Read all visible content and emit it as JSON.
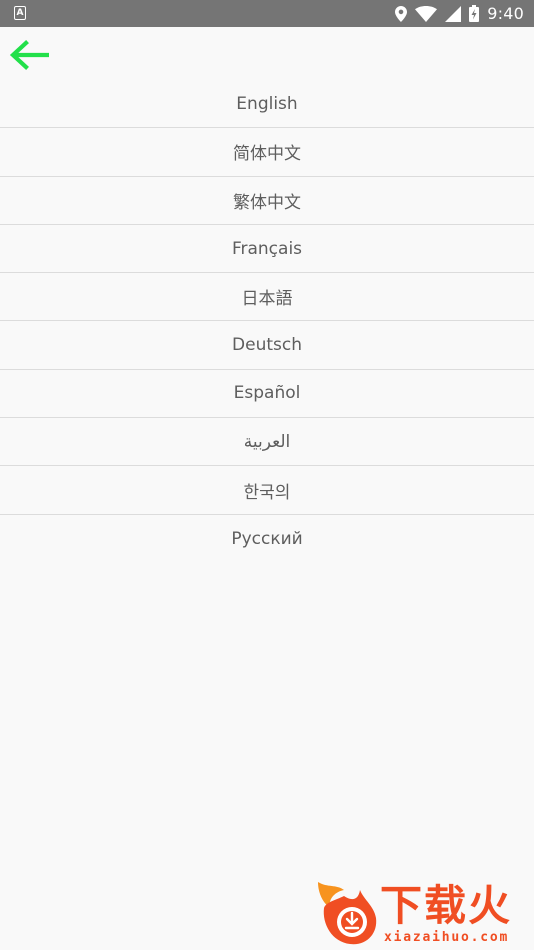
{
  "status_bar": {
    "notification_glyph": "A",
    "time": "9:40",
    "icons": [
      "location-icon",
      "wifi-icon",
      "signal-icon",
      "battery-charging-icon"
    ]
  },
  "toolbar": {
    "back_icon": "arrow-left-icon",
    "accent_color": "#22e04a"
  },
  "languages": [
    "English",
    "简体中文",
    "繁体中文",
    "Français",
    "日本語",
    "Deutsch",
    "Español",
    "العربية",
    "한국의",
    "Русский"
  ],
  "watermark": {
    "title": "下载火",
    "url": "xiazaihuo.com",
    "color": "#f04e23"
  }
}
